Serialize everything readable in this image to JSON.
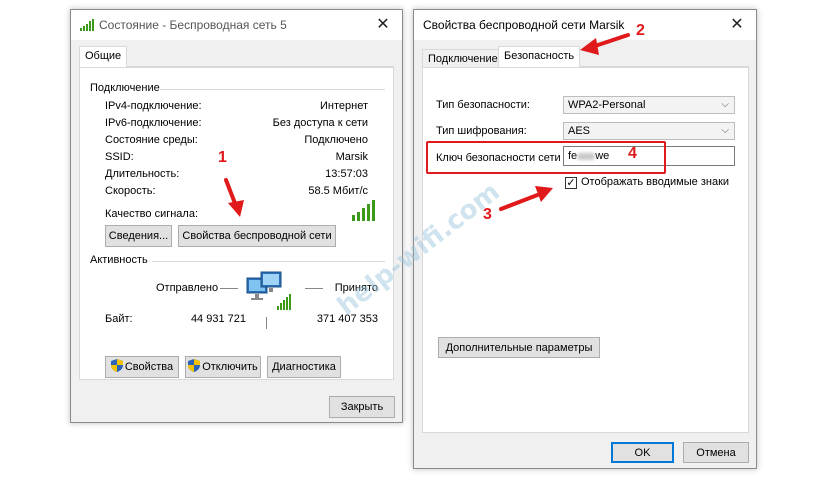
{
  "status_window": {
    "title": "Состояние - Беспроводная сеть 5",
    "tab": "Общие",
    "connection_group": "Подключение",
    "rows": [
      {
        "label": "IPv4-подключение:",
        "value": "Интернет"
      },
      {
        "label": "IPv6-подключение:",
        "value": "Без доступа к сети"
      },
      {
        "label": "Состояние среды:",
        "value": "Подключено"
      },
      {
        "label": "SSID:",
        "value": "Marsik"
      },
      {
        "label": "Длительность:",
        "value": "13:57:03"
      },
      {
        "label": "Скорость:",
        "value": "58.5 Мбит/с"
      }
    ],
    "signal_label": "Качество сигнала:",
    "details_button": "Сведения...",
    "wireless_props_button": "Свойства беспроводной сети",
    "activity_group": "Активность",
    "sent_label": "Отправлено",
    "received_label": "Принято",
    "bytes_label": "Байт:",
    "bytes_sent": "44 931 721",
    "bytes_received": "371 407 353",
    "properties_button": "Свойства",
    "disable_button": "Отключить",
    "diagnostics_button": "Диагностика",
    "close_button": "Закрыть"
  },
  "props_window": {
    "title": "Свойства беспроводной сети Marsik",
    "tabs": [
      "Подключение",
      "Безопасность"
    ],
    "security_type_label": "Тип безопасности:",
    "security_type_value": "WPA2-Personal",
    "encryption_label": "Тип шифрования:",
    "encryption_value": "AES",
    "key_label": "Ключ безопасности сети",
    "key_value_start": "fe",
    "key_value_end": "we",
    "show_chars_label": "Отображать вводимые знаки",
    "show_chars_checked": true,
    "advanced_button": "Дополнительные параметры",
    "ok_button": "OK",
    "cancel_button": "Отмена"
  },
  "annotations": [
    "1",
    "2",
    "3",
    "4"
  ],
  "watermark": "help-wifi.com",
  "colors": {
    "annotation": "#e0191b",
    "signal_bars": "#3c9a1a",
    "focus_blue": "#0078d7"
  }
}
